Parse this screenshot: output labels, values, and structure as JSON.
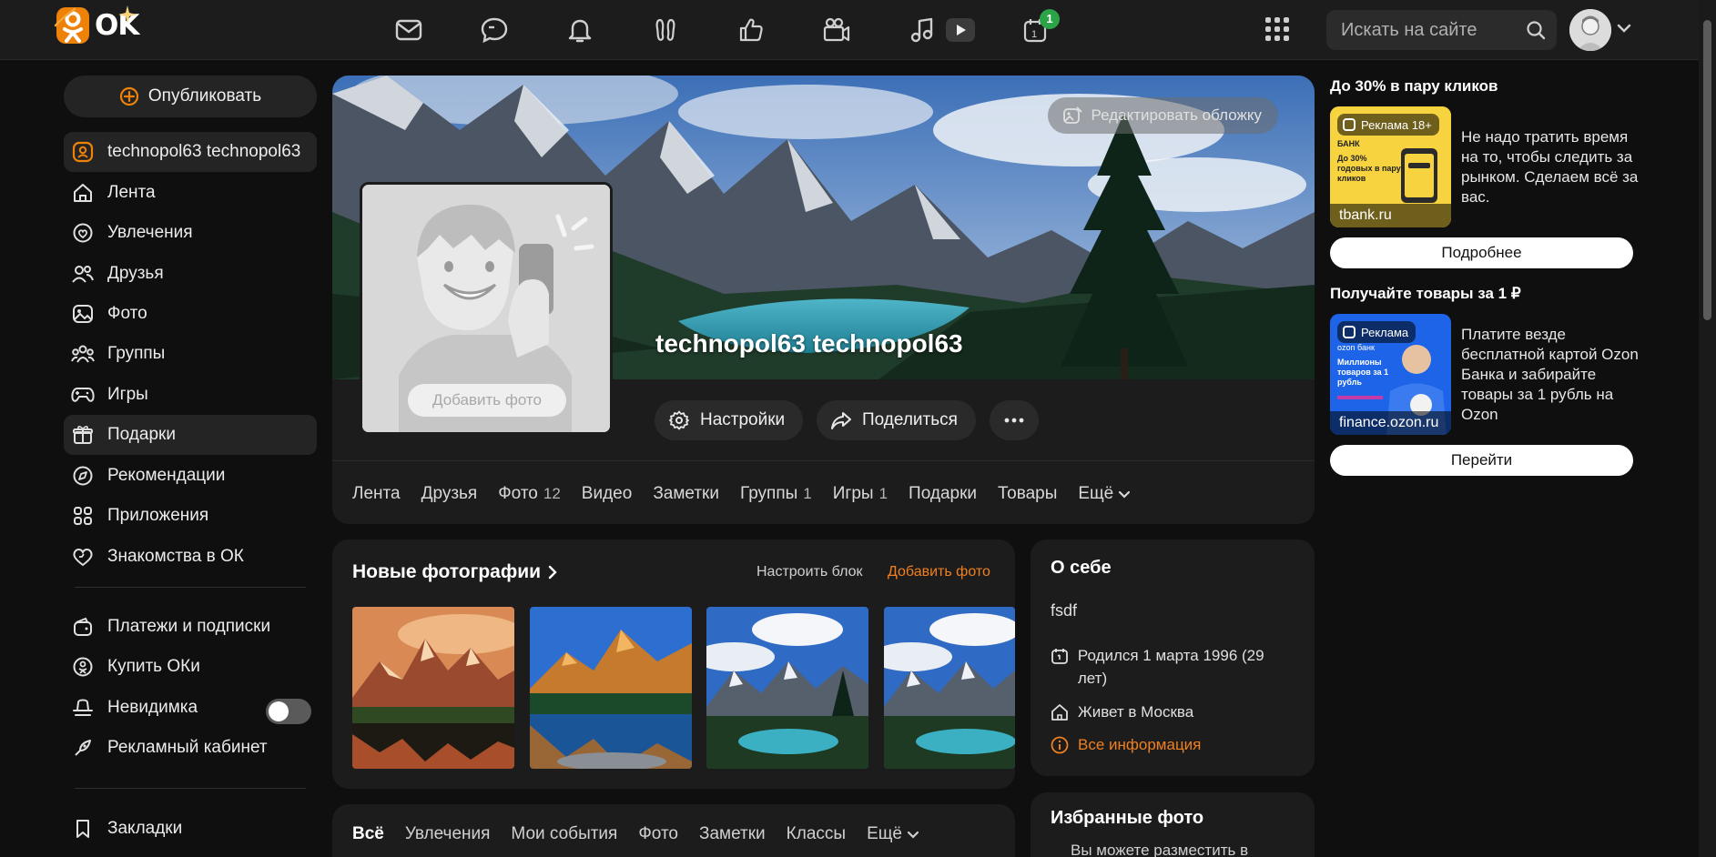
{
  "header": {
    "logo_text": "OK",
    "search_placeholder": "Искать на сайте",
    "notifications_badge": "1",
    "icons": [
      "mail-icon",
      "chat-icon",
      "bell-icon",
      "guests-icon",
      "like-icon",
      "events-icon",
      "music-icon",
      "video-icon",
      "calendar-icon",
      "apps-grid-icon"
    ]
  },
  "sidebar": {
    "publish_label": "Опубликовать",
    "profile_label": "technopol63 technopol63",
    "items": [
      {
        "label": "Лента",
        "icon": "home-icon"
      },
      {
        "label": "Увлечения",
        "icon": "hobby-icon"
      },
      {
        "label": "Друзья",
        "icon": "friends-icon"
      },
      {
        "label": "Фото",
        "icon": "photo-icon"
      },
      {
        "label": "Группы",
        "icon": "groups-icon"
      },
      {
        "label": "Игры",
        "icon": "games-icon"
      },
      {
        "label": "Подарки",
        "icon": "gift-icon"
      },
      {
        "label": "Рекомендации",
        "icon": "compass-icon"
      },
      {
        "label": "Приложения",
        "icon": "apps-icon"
      },
      {
        "label": "Знакомства в ОК",
        "icon": "heart-icon"
      }
    ],
    "secondary": [
      {
        "label": "Платежи и подписки",
        "icon": "wallet-icon"
      },
      {
        "label": "Купить ОКи",
        "icon": "coins-icon"
      },
      {
        "label": "Невидимка",
        "icon": "incognito-icon"
      },
      {
        "label": "Рекламный кабинет",
        "icon": "ads-cabinet-icon"
      }
    ],
    "bookmarks_label": "Закладки",
    "invisible_enabled": false
  },
  "profile": {
    "name": "technopol63 technopol63",
    "edit_cover_label": "Редактировать обложку",
    "add_photo_label": "Добавить фото",
    "settings_label": "Настройки",
    "share_label": "Поделиться",
    "tabs": [
      {
        "label": "Лента",
        "count": ""
      },
      {
        "label": "Друзья",
        "count": ""
      },
      {
        "label": "Фото",
        "count": "12"
      },
      {
        "label": "Видео",
        "count": ""
      },
      {
        "label": "Заметки",
        "count": ""
      },
      {
        "label": "Группы",
        "count": "1"
      },
      {
        "label": "Игры",
        "count": "1"
      },
      {
        "label": "Подарки",
        "count": ""
      },
      {
        "label": "Товары",
        "count": ""
      },
      {
        "label": "Ещё",
        "count": ""
      }
    ]
  },
  "photos": {
    "title": "Новые фотографии",
    "configure_label": "Настроить блок",
    "add_label": "Добавить фото"
  },
  "about": {
    "title": "О себе",
    "text": "fsdf",
    "birthday": "Родился 1 марта 1996 (29 лет)",
    "lives": "Живет в Москва",
    "all_info": "Все информация"
  },
  "feed_tabs": [
    "Всё",
    "Увлечения",
    "Мои события",
    "Фото",
    "Заметки",
    "Классы",
    "Ещё"
  ],
  "favorites": {
    "title": "Избранные фото",
    "subtitle": "Вы можете разместить в"
  },
  "ads": [
    {
      "title": "До 30% в пару кликов",
      "chip": "Реклама 18+",
      "domain": "tbank.ru",
      "text": "Не надо тратить время на то, чтобы следить за рынком. Сделаем всё за вас.",
      "button": "Подробнее",
      "bank_label": "БАНК",
      "image_caption": "До 30% годовых в пару кликов",
      "color": "#f7d33f"
    },
    {
      "title": "Получайте товары за 1 ₽",
      "chip": "Реклама",
      "domain": "finance.ozon.ru",
      "text": "Платите везде бесплатной картой Ozon Банка и забирайте товары за 1 рубль на Ozon",
      "button": "Перейти",
      "bank_label": "ozon банк",
      "image_caption": "Миллионы товаров за 1 рубль",
      "color": "#1d64e8"
    }
  ],
  "colors": {
    "accent": "#ee8208",
    "link": "#f0801f",
    "badge_green": "#2aa447",
    "background": "#0f0f0f",
    "card": "#1c1c1d"
  }
}
